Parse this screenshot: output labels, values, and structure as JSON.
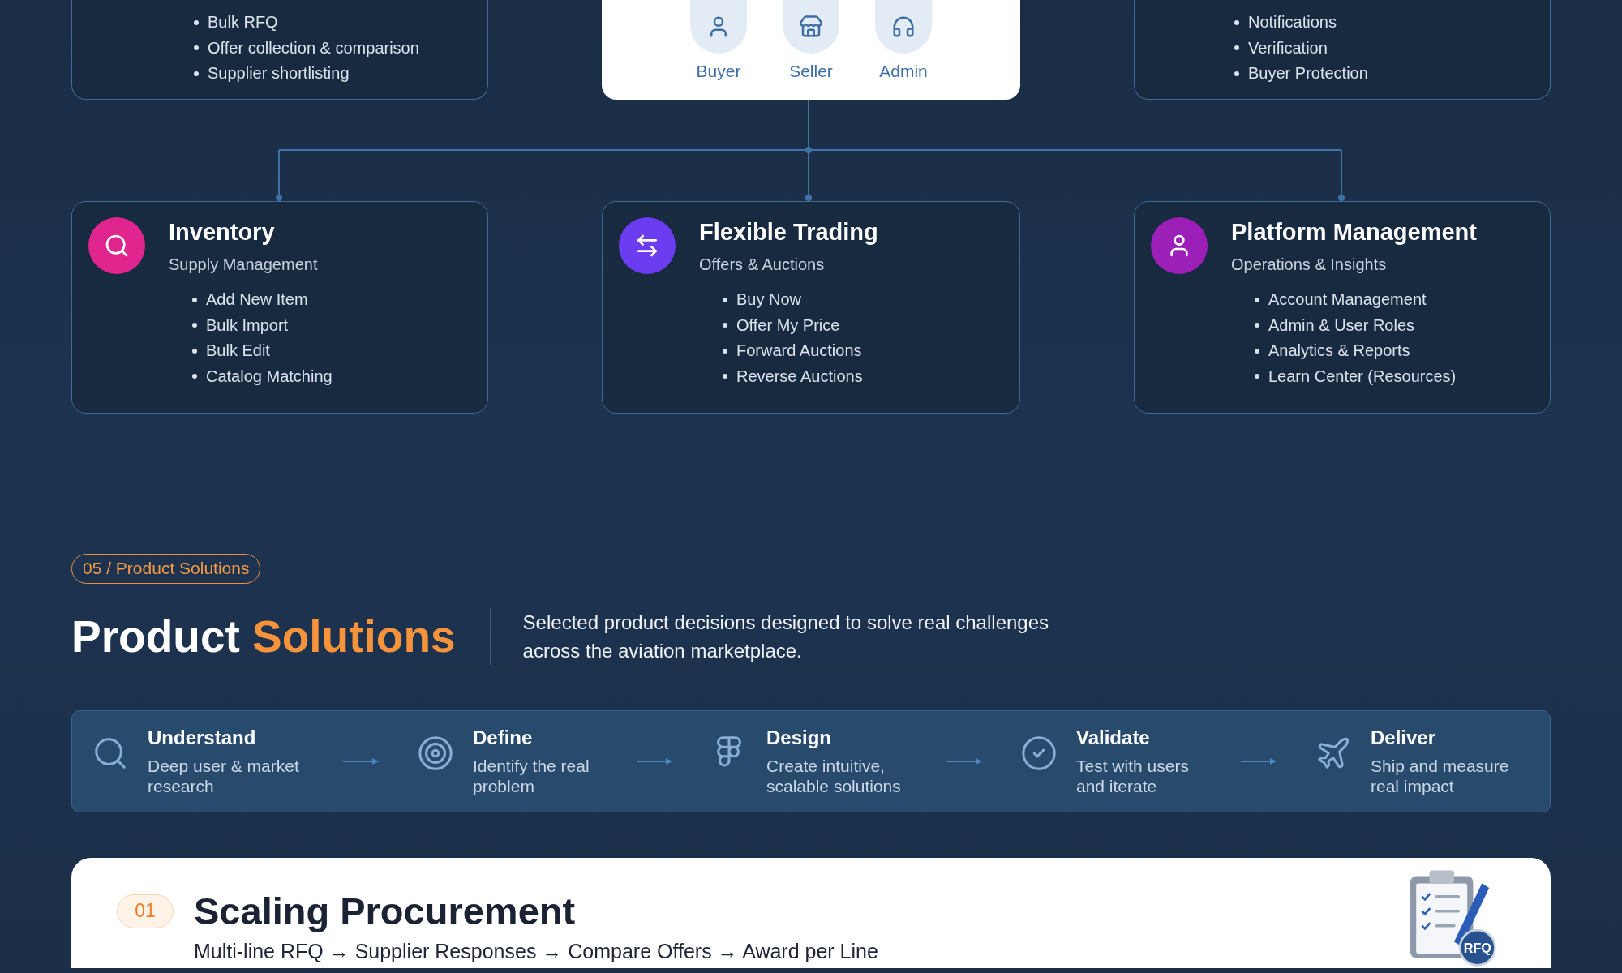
{
  "top_cards": [
    {
      "items": [
        "Bulk RFQ",
        "Offer collection & comparison",
        "Supplier shortlisting"
      ]
    },
    {
      "items": [
        "Notifications",
        "Verification",
        "Buyer Protection"
      ]
    }
  ],
  "roles": [
    {
      "kind": "user",
      "label": "Buyer"
    },
    {
      "kind": "store",
      "label": "Seller"
    },
    {
      "kind": "headset",
      "label": "Admin"
    }
  ],
  "modules": [
    {
      "kind": "search",
      "color": "#e0258f",
      "title": "Inventory",
      "subtitle": "Supply Management",
      "items": [
        "Add New Item",
        "Bulk Import",
        "Bulk Edit",
        "Catalog Matching"
      ]
    },
    {
      "kind": "swap",
      "color": "#6b3cf0",
      "title": "Flexible Trading",
      "subtitle": "Offers & Auctions",
      "items": [
        "Buy Now",
        "Offer My Price",
        "Forward Auctions",
        "Reverse Auctions"
      ]
    },
    {
      "kind": "user",
      "color": "#9c1fb8",
      "title": "Platform Management",
      "subtitle": "Operations & Insights",
      "items": [
        "Account Management",
        "Admin & User Roles",
        "Analytics & Reports",
        "Learn Center (Resources)"
      ]
    }
  ],
  "section": {
    "tag": "05 / Product Solutions",
    "title": "Product",
    "title_highlight": "Solutions",
    "description_lines": [
      "Selected product decisions designed to solve real challenges",
      "across the aviation marketplace."
    ]
  },
  "process": [
    {
      "kind": "search",
      "title": "Understand",
      "description_lines": [
        "Deep user & market",
        "research"
      ]
    },
    {
      "kind": "target",
      "title": "Define",
      "description_lines": [
        "Identify the real",
        "problem"
      ]
    },
    {
      "kind": "figma",
      "title": "Design",
      "description_lines": [
        "Create intuitive,",
        "scalable solutions"
      ]
    },
    {
      "kind": "check",
      "title": "Validate",
      "description_lines": [
        "Test with users",
        "and iterate"
      ]
    },
    {
      "kind": "plane",
      "title": "Deliver",
      "description_lines": [
        "Ship and measure",
        "real impact"
      ]
    }
  ],
  "solution_card": {
    "number": "01",
    "title": "Scaling Procurement",
    "flow": "Multi-line RFQ → Supplier Responses → Compare Offers → Award per Line",
    "illustration_label": "RFQ"
  }
}
